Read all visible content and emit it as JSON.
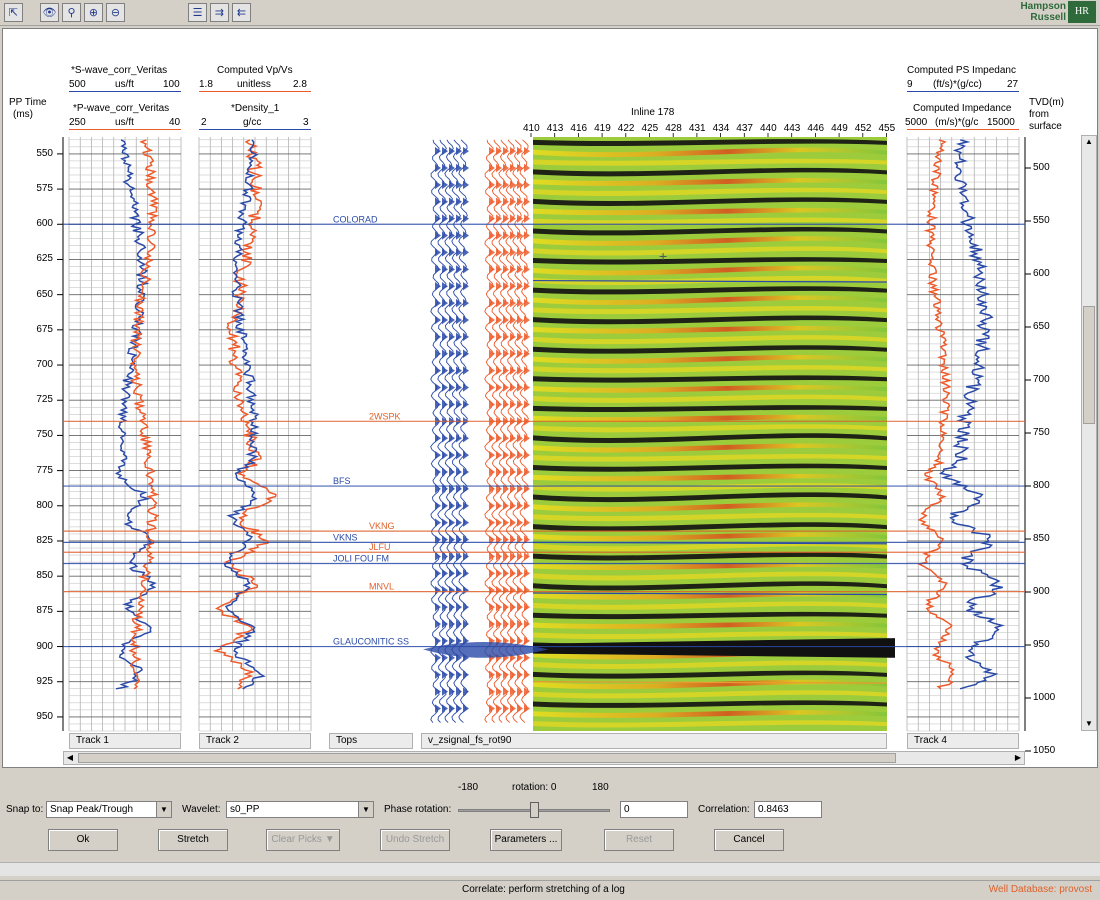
{
  "toolbar": {
    "icons": [
      "export-icon",
      "eye-icon",
      "zoom-icon",
      "zoom-in-icon",
      "zoom-out-icon",
      "layout-icon",
      "forward-icon",
      "back-icon"
    ],
    "logo_line1": "Hampson",
    "logo_line2": "Russell",
    "logo_mark": "HR"
  },
  "plot": {
    "left_axis_title1": "PP Time",
    "left_axis_title2": "(ms)",
    "right_axis_title1": "TVD(m)",
    "right_axis_title2": "from",
    "right_axis_title3": "surface",
    "time_ticks": [
      "550",
      "575",
      "600",
      "625",
      "650",
      "675",
      "700",
      "725",
      "750",
      "775",
      "800",
      "825",
      "850",
      "875",
      "900",
      "925",
      "950"
    ],
    "tvd_ticks": [
      "500",
      "550",
      "600",
      "650",
      "700",
      "750",
      "800",
      "850",
      "900",
      "950",
      "1000",
      "1050"
    ],
    "track1": {
      "top_name": "*S-wave_corr_Veritas",
      "top_min": "500",
      "top_unit": "us/ft",
      "top_max": "100",
      "bottom_name": "*P-wave_corr_Veritas",
      "bottom_min": "250",
      "bottom_unit": "us/ft",
      "bottom_max": "40",
      "label": "Track 1"
    },
    "track2": {
      "top_name": "Computed Vp/Vs",
      "top_min": "1.8",
      "top_unit": "unitless",
      "top_max": "2.8",
      "bottom_name": "*Density_1",
      "bottom_min": "2",
      "bottom_unit": "g/cc",
      "bottom_max": "3",
      "label": "Track 2"
    },
    "track4": {
      "top_name": "Computed PS Impedanc",
      "top_min": "9",
      "top_unit": "(ft/s)*(g/cc)",
      "top_max": "27",
      "bottom_name": "Computed Impedance",
      "bottom_min": "5000",
      "bottom_unit": "(m/s)*(g/c",
      "bottom_max": "15000",
      "label": "Track 4"
    },
    "tops_label": "Tops",
    "seismic_label": "v_zsignal_fs_rot90",
    "inline_title": "Inline 178",
    "cdp_ticks": [
      "410",
      "413",
      "416",
      "419",
      "422",
      "425",
      "428",
      "431",
      "434",
      "437",
      "440",
      "443",
      "446",
      "449",
      "452",
      "455"
    ],
    "tops": [
      {
        "name": "COLORAD",
        "time": 600,
        "color": "#2a4aa8"
      },
      {
        "name": "2WSPK",
        "time": 740,
        "color": "#e0602a"
      },
      {
        "name": "BFS",
        "time": 786,
        "color": "#2a4aa8"
      },
      {
        "name": "VKNG",
        "time": 818,
        "color": "#e0602a"
      },
      {
        "name": "VKNS",
        "time": 826,
        "color": "#2a4aa8"
      },
      {
        "name": "JLFU",
        "time": 833,
        "color": "#e0602a"
      },
      {
        "name": "JOLI FOU FM",
        "time": 841,
        "color": "#2a4aa8"
      },
      {
        "name": "MNVL",
        "time": 861,
        "color": "#e0602a"
      },
      {
        "name": "GLAUCONITIC SS",
        "time": 900,
        "color": "#2a4aa8"
      }
    ]
  },
  "controls": {
    "snap_label": "Snap to:",
    "snap_value": "Snap Peak/Trough",
    "wavelet_label": "Wavelet:",
    "wavelet_value": "s0_PP",
    "phase_label": "Phase rotation:",
    "rot_min": "-180",
    "rot_title": "rotation: 0",
    "rot_max": "180",
    "rotation_value": 0,
    "phase_value": "0",
    "corr_label": "Correlation:",
    "corr_value": "0.8463",
    "ok": "Ok",
    "stretch": "Stretch",
    "clear_picks": "Clear Picks",
    "undo_stretch": "Undo Stretch",
    "parameters": "Parameters ...",
    "reset": "Reset",
    "cancel": "Cancel"
  },
  "status": {
    "message": "Correlate: perform stretching of a log",
    "database": "Well Database: provost"
  },
  "colors": {
    "blue": "#2a4aa8",
    "red": "#ee5a2a"
  }
}
